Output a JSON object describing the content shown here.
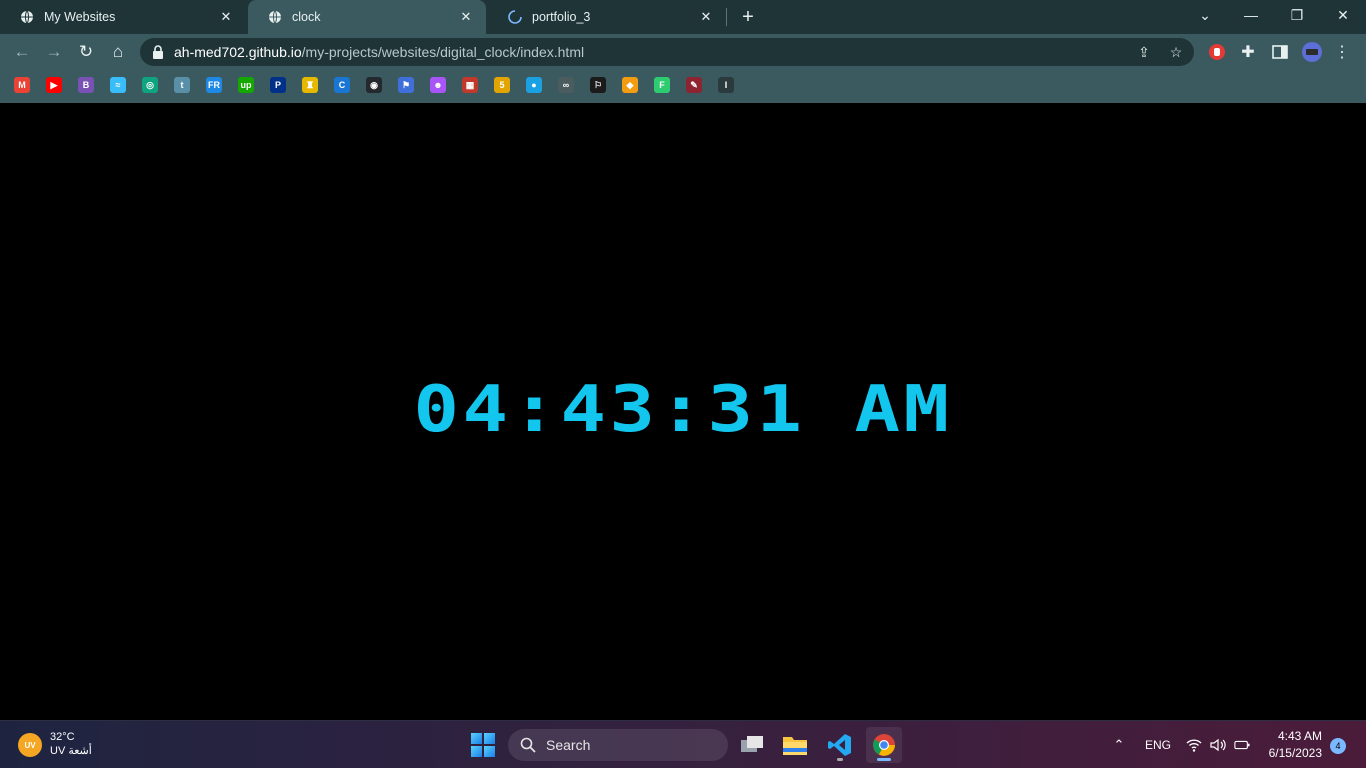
{
  "browser": {
    "tabs": [
      {
        "title": "My Websites",
        "favicon": "globe-icon",
        "active": false
      },
      {
        "title": "clock",
        "favicon": "globe-icon",
        "active": true
      },
      {
        "title": "portfolio_3",
        "favicon": "loading-spinner-icon",
        "active": false
      }
    ],
    "new_tab_label": "+",
    "url_host": "ah-med702.github.io",
    "url_path": "/my-projects/websites/digital_clock/index.html",
    "bookmarks": [
      {
        "name": "gmail-icon",
        "label": "M",
        "color": "#ea4335"
      },
      {
        "name": "youtube-icon",
        "label": "▶",
        "color": "#ff0000"
      },
      {
        "name": "bootstrap-icon",
        "label": "B",
        "color": "#7952b3"
      },
      {
        "name": "tailwind-icon",
        "label": "≈",
        "color": "#38bdf8"
      },
      {
        "name": "chatgpt-icon",
        "label": "◎",
        "color": "#10a37f"
      },
      {
        "name": "tumblr-icon",
        "label": "t",
        "color": "#5a8fa8"
      },
      {
        "name": "fr-icon",
        "label": "FR",
        "color": "#1e88e5"
      },
      {
        "name": "upwork-icon",
        "label": "up",
        "color": "#14a800"
      },
      {
        "name": "paypal-icon",
        "label": "P",
        "color": "#003087"
      },
      {
        "name": "shield-icon",
        "label": "♜",
        "color": "#e6b800"
      },
      {
        "name": "c-icon",
        "label": "C",
        "color": "#1976d2"
      },
      {
        "name": "github-icon",
        "label": "◉",
        "color": "#24292e"
      },
      {
        "name": "flag-icon",
        "label": "⚑",
        "color": "#3f6fd8"
      },
      {
        "name": "chat-bot-icon",
        "label": "☻",
        "color": "#a855f7"
      },
      {
        "name": "grid-icon",
        "label": "▦",
        "color": "#c0392b"
      },
      {
        "name": "five-icon",
        "label": "5",
        "color": "#e2a400"
      },
      {
        "name": "circle-icon",
        "label": "●",
        "color": "#1ba1e2"
      },
      {
        "name": "link-icon",
        "label": "∞",
        "color": "#4a5c5e"
      },
      {
        "name": "pen-flag-icon",
        "label": "⚐",
        "color": "#1b1b1b"
      },
      {
        "name": "diamond-icon",
        "label": "◆",
        "color": "#f39c12"
      },
      {
        "name": "frontend-icon",
        "label": "F",
        "color": "#2ecc71"
      },
      {
        "name": "dev-icon",
        "label": "✎",
        "color": "#8e2430"
      },
      {
        "name": "text-cursor-icon",
        "label": "I",
        "color": "#2b3b3d"
      }
    ]
  },
  "page": {
    "clock_text": "04:43:31 AM",
    "clock_color": "#12c6ee",
    "background": "#000000"
  },
  "taskbar": {
    "weather_badge": "UV",
    "temperature": "32°C",
    "weather_desc": "UV أشعة",
    "search_label": "Search",
    "language": "ENG",
    "time": "4:43 AM",
    "date": "6/15/2023",
    "notification_count": "4"
  }
}
